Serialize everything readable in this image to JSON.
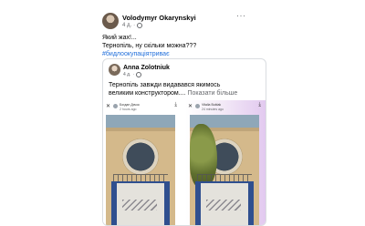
{
  "post": {
    "author": "Volodymyr Okarynskyi",
    "time": "4 д.",
    "more": "···",
    "lines": [
      "Який жах!...",
      "Тернопіль, ну скільки можна???"
    ],
    "hashtag": "#бидлоокупаціятриває"
  },
  "shared": {
    "author": "Anna Zolotniuk",
    "time": "4 д.",
    "text_line1": "Тернопіль завжди видавався якимось",
    "text_line2": "великим конструктором....",
    "see_more": "Показати більше"
  },
  "panels": [
    {
      "name": "Богдан Дячок",
      "time": "2 hours ago",
      "close": "✕",
      "download": "⤓"
    },
    {
      "name": "Vitalia Bublak",
      "time": "24 minutes ago",
      "close": "✕",
      "download": "⤓"
    }
  ],
  "icons": {
    "globe": "globe-icon",
    "close": "close-icon",
    "download": "download-icon"
  }
}
